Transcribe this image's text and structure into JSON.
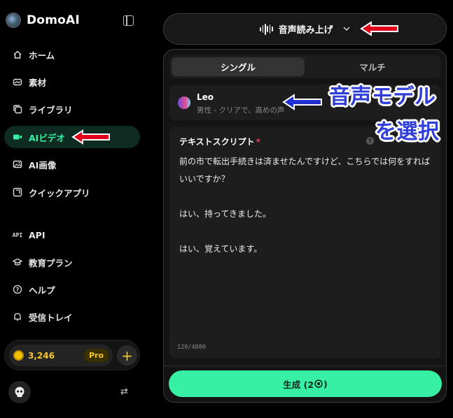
{
  "app": {
    "name": "DomoAI"
  },
  "sidebar": {
    "items": [
      {
        "label": "ホーム",
        "icon": "home-icon"
      },
      {
        "label": "素材",
        "icon": "asset-icon"
      },
      {
        "label": "ライブラリ",
        "icon": "library-icon"
      },
      {
        "label": "AIビデオ",
        "icon": "video-camera-icon",
        "active": true
      },
      {
        "label": "AI画像",
        "icon": "image-icon"
      },
      {
        "label": "クイックアプリ",
        "icon": "quick-app-icon"
      },
      {
        "label": "API",
        "icon": "api-icon"
      },
      {
        "label": "教育プラン",
        "icon": "graduation-cap-icon"
      },
      {
        "label": "ヘルプ",
        "icon": "help-circle-icon"
      },
      {
        "label": "受信トレイ",
        "icon": "bell-icon"
      }
    ],
    "credits": "3,246",
    "plan_badge": "Pro",
    "add_label": "+",
    "switch_glyph": "⇄"
  },
  "header": {
    "title": "音声読み上げ"
  },
  "tabs": [
    {
      "label": "シングル",
      "active": true
    },
    {
      "label": "マルチ",
      "active": false
    }
  ],
  "voice": {
    "name": "Leo",
    "description": "男性 - クリアで、高めの声"
  },
  "script": {
    "label": "テキストスクリプト",
    "required_mark": "*",
    "help_glyph": "?",
    "paragraphs": [
      "前の市で転出手続きは済ませたんですけど、こちらでは何をすればいいですか？",
      "",
      "はい、持ってきました。",
      "",
      "はい、覚えています。"
    ],
    "counter": "120/4000"
  },
  "generate": {
    "label": "生成 (2",
    "suffix": ")"
  },
  "annotations": {
    "callout_line1": "音声モデル",
    "callout_line2": "を選択"
  },
  "colors": {
    "accent": "#37f0a4",
    "active_bg": "#0e2b22",
    "credits": "#f3c72b",
    "arrow_red": "#e0001a",
    "arrow_blue": "#1f2fd0"
  }
}
